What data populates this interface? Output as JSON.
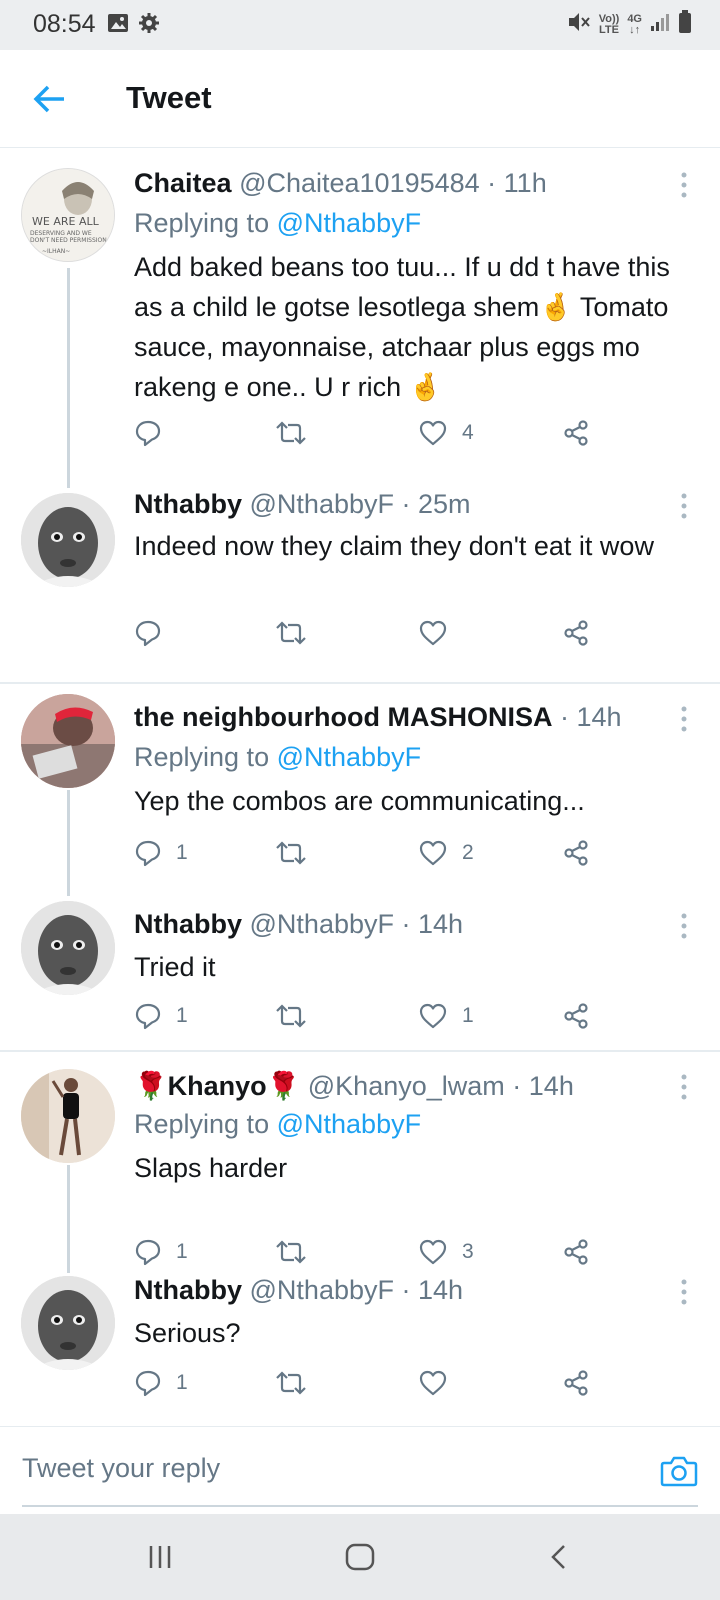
{
  "status": {
    "time": "08:54",
    "net_top": "Vo))",
    "net_bottom": "LTE",
    "gen": "4G"
  },
  "header": {
    "title": "Tweet"
  },
  "tweets": [
    {
      "name": "Chaitea",
      "handle": "@Chaitea10195484",
      "time": "11h",
      "replying_label": "Replying to",
      "replying_handle": "@NthabbyF",
      "text": "Add baked beans too tuu... If u dd t have this as a child le gotse lesotlega shem🤞 Tomato sauce, mayonnaise, atchaar plus eggs mo rakeng e one.. U r rich 🤞",
      "replies": "",
      "retweets": "",
      "likes": "4"
    },
    {
      "name": "Nthabby",
      "handle": "@NthabbyF",
      "time": "25m",
      "text": "Indeed  now they claim they don't eat it wow",
      "replies": "",
      "retweets": "",
      "likes": ""
    },
    {
      "name": "the neighbourhood MASHONISA",
      "handle": "",
      "time": "14h",
      "replying_label": "Replying to",
      "replying_handle": "@NthabbyF",
      "text": "Yep the combos are communicating...",
      "replies": "1",
      "retweets": "",
      "likes": "2"
    },
    {
      "name": "Nthabby",
      "handle": "@NthabbyF",
      "time": "14h",
      "text": "Tried it",
      "replies": "1",
      "retweets": "",
      "likes": "1"
    },
    {
      "name": "🌹Khanyo🌹",
      "handle": "@Khanyo_lwam",
      "time": "14h",
      "replying_label": "Replying to",
      "replying_handle": "@NthabbyF",
      "text": "Slaps harder",
      "replies": "1",
      "retweets": "",
      "likes": "3"
    },
    {
      "name": "Nthabby",
      "handle": "@NthabbyF",
      "time": "14h",
      "text": "Serious?",
      "replies": "1",
      "retweets": "",
      "likes": ""
    }
  ],
  "composer": {
    "placeholder": "Tweet your reply"
  },
  "colors": {
    "accent": "#1da1f2",
    "muted": "#657786",
    "text": "#14171a",
    "divider": "#e6ecf0"
  }
}
